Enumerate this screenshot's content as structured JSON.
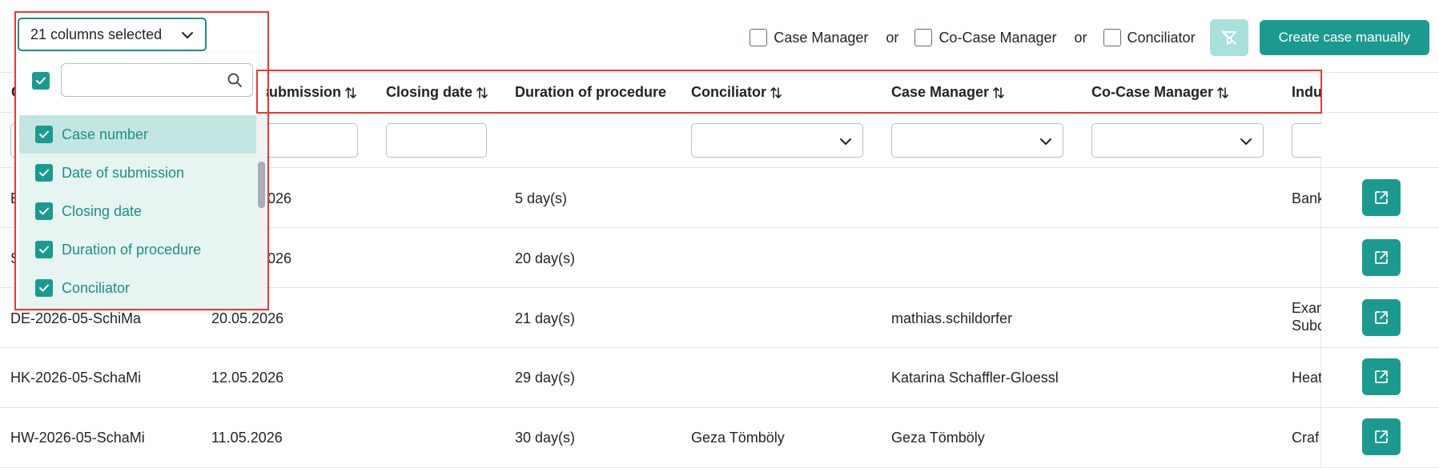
{
  "column_selector": {
    "label": "21 columns selected"
  },
  "filters": {
    "case_manager": "Case Manager",
    "or_1": "or",
    "co_case_manager": "Co-Case Manager",
    "or_2": "or",
    "conciliator": "Conciliator"
  },
  "create_button": "Create case manually",
  "table": {
    "headers": {
      "case_number_partial": "C",
      "date_of_submission_partial": "submission",
      "closing_date": "Closing date",
      "duration": "Duration of procedure",
      "conciliator": "Conciliator",
      "case_manager": "Case Manager",
      "co_case_manager": "Co-Case Manager",
      "industry_partial": "Indu"
    },
    "rows": [
      {
        "case_number": "B",
        "submission": "026",
        "duration": "5 day(s)",
        "conciliator": "",
        "case_manager": "",
        "industry": "Bank"
      },
      {
        "case_number": "S",
        "submission": "026",
        "duration": "20 day(s)",
        "conciliator": "",
        "case_manager": "",
        "industry": ""
      },
      {
        "case_number": "DE-2026-05-SchiMa",
        "submission": "20.05.2026",
        "duration": "21 day(s)",
        "conciliator": "",
        "case_manager": "mathias.schildorfer",
        "industry_line1": "Exam",
        "industry_line2": "Subc"
      },
      {
        "case_number": "HK-2026-05-SchaMi",
        "submission": "12.05.2026",
        "duration": "29 day(s)",
        "conciliator": "",
        "case_manager": "Katarina Schaffler-Gloessl",
        "industry": "Heat"
      },
      {
        "case_number": "HW-2026-05-SchaMi",
        "submission": "11.05.2026",
        "duration": "30 day(s)",
        "conciliator": "Geza Tömböly",
        "case_manager": "Geza Tömböly",
        "industry": "Craf"
      }
    ]
  },
  "column_dropdown": {
    "search_placeholder": "",
    "items": [
      {
        "label": "Case number",
        "checked": true
      },
      {
        "label": "Date of submission",
        "checked": true
      },
      {
        "label": "Closing date",
        "checked": true
      },
      {
        "label": "Duration of procedure",
        "checked": true
      },
      {
        "label": "Conciliator",
        "checked": true
      }
    ]
  },
  "colors": {
    "accent": "#1d9a8f",
    "annotation": "#e53935",
    "dropdown_bg": "#e6f4f2"
  },
  "icons": {
    "dropdown": "chevron-down-icon",
    "search": "search-icon",
    "filter_reset": "filter-off-icon",
    "open": "external-link-icon",
    "sort": "sort-icon",
    "check": "check-icon"
  }
}
